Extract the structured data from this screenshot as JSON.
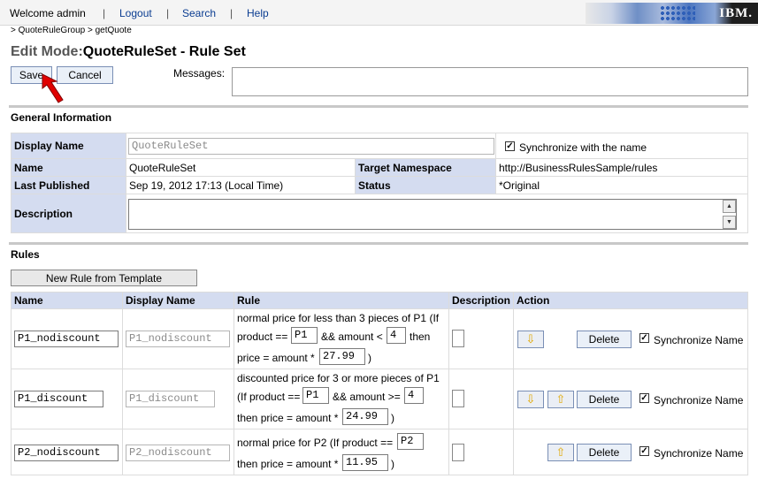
{
  "nav": {
    "welcome": "Welcome admin",
    "logout": "Logout",
    "search": "Search",
    "help": "Help",
    "separator": "|",
    "logo": "IBM."
  },
  "breadcrumb": "> QuoteRuleGroup > getQuote",
  "title": {
    "mode": "Edit Mode:",
    "name": "QuoteRuleSet - Rule Set"
  },
  "actions": {
    "save": "Save",
    "cancel": "Cancel",
    "messages_label": "Messages:"
  },
  "general": {
    "section_title": "General Information",
    "display_name_label": "Display Name",
    "display_name_value": "QuoteRuleSet",
    "sync_label": "Synchronize with the name",
    "name_label": "Name",
    "name_value": "QuoteRuleSet",
    "target_ns_label": "Target Namespace",
    "target_ns_value": "http://BusinessRulesSample/rules",
    "last_published_label": "Last Published",
    "last_published_value": "Sep 19, 2012 17:13 (Local Time)",
    "status_label": "Status",
    "status_value": "*Original",
    "description_label": "Description"
  },
  "rules": {
    "section_title": "Rules",
    "new_rule_button": "New Rule from Template",
    "columns": [
      "Name",
      "Display Name",
      "Rule",
      "Description",
      "Action"
    ],
    "delete_label": "Delete",
    "sync_name_label": "Synchronize Name",
    "rows": [
      {
        "name": "P1_nodiscount",
        "display_name": "P1_nodiscount",
        "line1": "normal price for less than 3 pieces of P1 (If",
        "line2_a": "product ==",
        "product": "P1",
        "line2_b": "&& amount <",
        "amount": "4",
        "line2_c": "then",
        "line3_a": "price = amount *",
        "price": "27.99",
        "line3_b": ")"
      },
      {
        "name": "P1_discount",
        "display_name": "P1_discount",
        "line1": "discounted price for 3 or more pieces of P1",
        "line2_a": "(If product ==",
        "product": "P1",
        "line2_b": "&& amount >=",
        "amount": "4",
        "line3_a": "then price = amount *",
        "price": "24.99",
        "line3_b": ")"
      },
      {
        "name": "P2_nodiscount",
        "display_name": "P2_nodiscount",
        "line1_a": "normal price for P2 (If product ==",
        "product": "P2",
        "line2_a": "then price = amount *",
        "price": "11.95",
        "line2_b": ")"
      }
    ]
  },
  "colors": {
    "header_bg": "#d4dcf0",
    "button_bg": "#eaf0f8",
    "arrow": "#e0a800",
    "cursor": "#e00000"
  }
}
